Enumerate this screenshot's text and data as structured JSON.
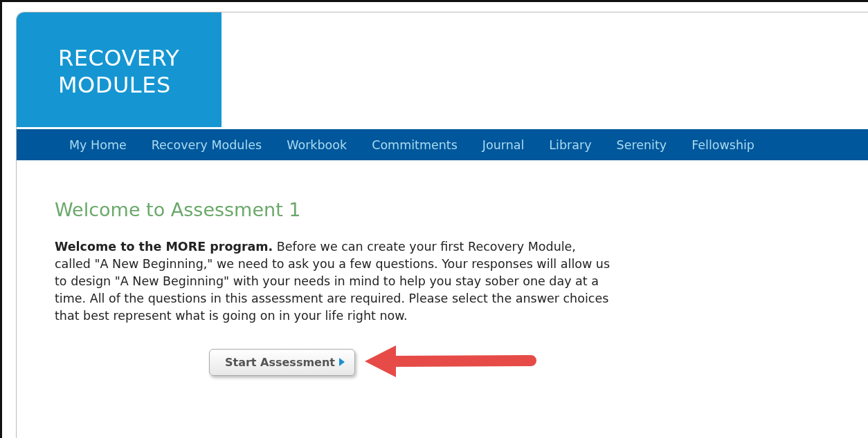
{
  "logo": {
    "lines": [
      "RECOVERY",
      "MODULES"
    ]
  },
  "nav": [
    {
      "label": "My Home"
    },
    {
      "label": "Recovery Modules"
    },
    {
      "label": "Workbook"
    },
    {
      "label": "Commitments"
    },
    {
      "label": "Journal"
    },
    {
      "label": "Library"
    },
    {
      "label": "Serenity"
    },
    {
      "label": "Fellowship"
    }
  ],
  "content": {
    "heading": "Welcome to Assessment 1",
    "intro": "**Welcome to the MORE program.** Before we can create your first Recovery Module, called \"A New Beginning,\" we need to ask you a few questions. Your responses will allow us to design \"A New Beginning\" with your needs in mind to help you stay sober one day at a time. All of the questions in this assessment are required. Please select the answer choices that best represent what is going on in your life right now.",
    "button": "Start Assessment"
  }
}
